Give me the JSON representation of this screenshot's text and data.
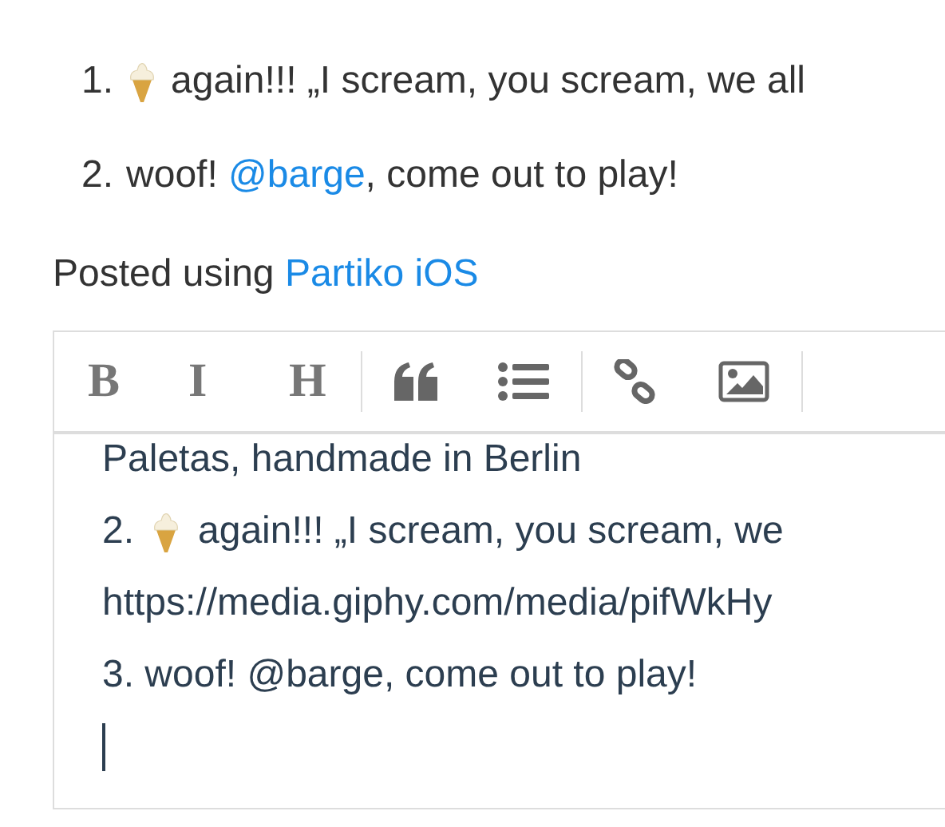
{
  "post": {
    "list": [
      {
        "number": "1.",
        "icon": true,
        "text": "again!!! „I scream, you scream, we all"
      },
      {
        "number": "2.",
        "icon": false,
        "parts": [
          {
            "text": "woof! ",
            "link": false
          },
          {
            "text": "@barge",
            "link": true
          },
          {
            "text": ", come out to play!",
            "link": false
          }
        ]
      }
    ],
    "footer": [
      {
        "text": "Posted using ",
        "link": false
      },
      {
        "text": "Partiko iOS",
        "link": true
      }
    ]
  },
  "editor": {
    "toolbar": [
      {
        "kind": "text",
        "label": "B"
      },
      {
        "kind": "text",
        "label": "I"
      },
      {
        "kind": "text",
        "label": "H"
      },
      {
        "kind": "separator"
      },
      {
        "kind": "quote"
      },
      {
        "kind": "list"
      },
      {
        "kind": "separator"
      },
      {
        "kind": "link"
      },
      {
        "kind": "image"
      },
      {
        "kind": "separator"
      }
    ],
    "lines": [
      {
        "text": "Paletas, handmade in Berlin",
        "icon": false
      },
      {
        "prefix": "2.",
        "text": "again!!! „I scream, you scream, we",
        "icon": true
      },
      {
        "text": "https://media.giphy.com/media/pifWkHy",
        "icon": false
      },
      {
        "text": "3. woof! @barge, come out to play!",
        "icon": false
      }
    ]
  }
}
